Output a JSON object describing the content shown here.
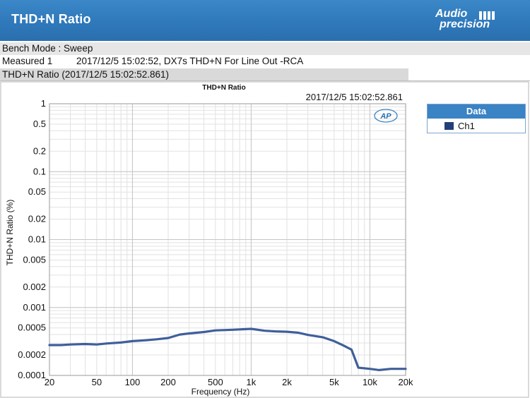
{
  "header": {
    "title": "THD+N Ratio",
    "logo_line1": "Audio",
    "logo_line2": "precision"
  },
  "info": {
    "bench_mode": "Bench Mode : Sweep",
    "measured_label": "Measured 1",
    "measured_text": "2017/12/5 15:02:52, DX7s THD+N For Line Out -RCA",
    "subtitle": "THD+N Ratio (2017/12/5 15:02:52.861)"
  },
  "legend": {
    "header": "Data",
    "item": "Ch1",
    "color": "#233f7a"
  },
  "chart_data": {
    "type": "line",
    "title": "THD+N Ratio",
    "timestamp": "2017/12/5 15:02:52.861",
    "badge": "AP",
    "xlabel": "Frequency (Hz)",
    "ylabel": "THD+N Ratio (%)",
    "x_scale": "log",
    "y_scale": "log",
    "xlim": [
      20,
      20000
    ],
    "ylim": [
      0.0001,
      1
    ],
    "grid": true,
    "x_ticks": [
      {
        "v": 20,
        "label": "20"
      },
      {
        "v": 50,
        "label": "50"
      },
      {
        "v": 100,
        "label": "100"
      },
      {
        "v": 200,
        "label": "200"
      },
      {
        "v": 500,
        "label": "500"
      },
      {
        "v": 1000,
        "label": "1k"
      },
      {
        "v": 2000,
        "label": "2k"
      },
      {
        "v": 5000,
        "label": "5k"
      },
      {
        "v": 10000,
        "label": "10k"
      },
      {
        "v": 20000,
        "label": "20k"
      }
    ],
    "y_ticks": [
      {
        "v": 1,
        "label": "1"
      },
      {
        "v": 0.5,
        "label": "0.5"
      },
      {
        "v": 0.2,
        "label": "0.2"
      },
      {
        "v": 0.1,
        "label": "0.1"
      },
      {
        "v": 0.05,
        "label": "0.05"
      },
      {
        "v": 0.02,
        "label": "0.02"
      },
      {
        "v": 0.01,
        "label": "0.01"
      },
      {
        "v": 0.005,
        "label": "0.005"
      },
      {
        "v": 0.002,
        "label": "0.002"
      },
      {
        "v": 0.001,
        "label": "0.001"
      },
      {
        "v": 0.0005,
        "label": "0.0005"
      },
      {
        "v": 0.0002,
        "label": "0.0002"
      },
      {
        "v": 0.0001,
        "label": "0.0001"
      }
    ],
    "series": [
      {
        "name": "Ch1",
        "color": "#3f5f9a",
        "x": [
          20,
          25,
          30,
          40,
          50,
          60,
          80,
          100,
          130,
          160,
          200,
          250,
          300,
          400,
          500,
          700,
          1000,
          1300,
          1600,
          2000,
          2500,
          3000,
          4000,
          5000,
          6000,
          7000,
          8000,
          10000,
          12000,
          15000,
          20000
        ],
        "y": [
          0.00028,
          0.00028,
          0.000285,
          0.00029,
          0.000285,
          0.000295,
          0.000305,
          0.00032,
          0.00033,
          0.00034,
          0.000355,
          0.0004,
          0.000415,
          0.000435,
          0.00046,
          0.00047,
          0.000485,
          0.000455,
          0.000445,
          0.00044,
          0.000425,
          0.000395,
          0.000365,
          0.00032,
          0.000275,
          0.00024,
          0.00013,
          0.000125,
          0.00012,
          0.000125,
          0.000125
        ]
      }
    ]
  }
}
